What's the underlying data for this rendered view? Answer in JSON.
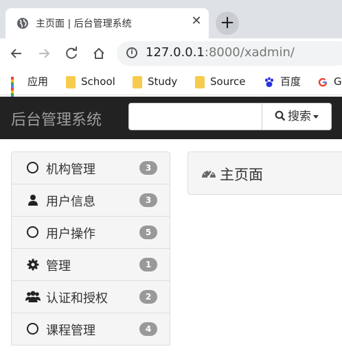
{
  "browser": {
    "tab_title": "主页面 | 后台管理系统",
    "close_glyph": "✕",
    "new_tab_glyph": "+",
    "url_host": "127.0.0.1",
    "url_rest": ":8000/xadmin/",
    "bookmarks": [
      "应用",
      "School",
      "Study",
      "Source",
      "百度",
      "G"
    ]
  },
  "navbar": {
    "brand": "后台管理系统",
    "search_placeholder": "",
    "search_button": "搜索"
  },
  "sidebar": {
    "items": [
      {
        "label": "机构管理",
        "badge": "3",
        "icon": "circle-icon"
      },
      {
        "label": "用户信息",
        "badge": "3",
        "icon": "user-icon"
      },
      {
        "label": "用户操作",
        "badge": "5",
        "icon": "circle-icon"
      },
      {
        "label": "管理",
        "badge": "1",
        "icon": "gear-icon"
      },
      {
        "label": "认证和授权",
        "badge": "2",
        "icon": "users-icon"
      },
      {
        "label": "课程管理",
        "badge": "4",
        "icon": "circle-icon"
      }
    ]
  },
  "main": {
    "panel_title": "主页面"
  },
  "colors": {
    "navbar_bg": "#222222",
    "badge_bg": "#999999",
    "folder": "#f7cb4d"
  }
}
